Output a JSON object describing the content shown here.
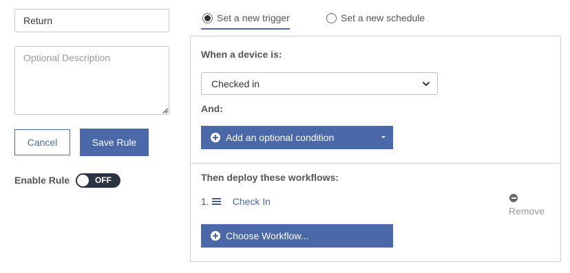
{
  "form": {
    "name_value": "Return",
    "description_placeholder": "Optional Description",
    "cancel_label": "Cancel",
    "save_label": "Save Rule",
    "enable_label": "Enable Rule",
    "toggle_state": "OFF"
  },
  "tabs": [
    {
      "label": "Set a new trigger",
      "selected": true
    },
    {
      "label": "Set a new schedule",
      "selected": false
    }
  ],
  "trigger": {
    "when_label": "When a device is:",
    "selected_option": "Checked in",
    "and_label": "And:",
    "add_condition_label": "Add an optional condition"
  },
  "workflows": {
    "heading": "Then deploy these workflows:",
    "items": [
      {
        "index": "1.",
        "name": "Check In",
        "remove_label": "Remove"
      }
    ],
    "choose_label": "Choose Workflow..."
  },
  "colors": {
    "accent": "#4b68a8",
    "toggle_bg": "#2b3242",
    "border": "#cfcfcf"
  }
}
